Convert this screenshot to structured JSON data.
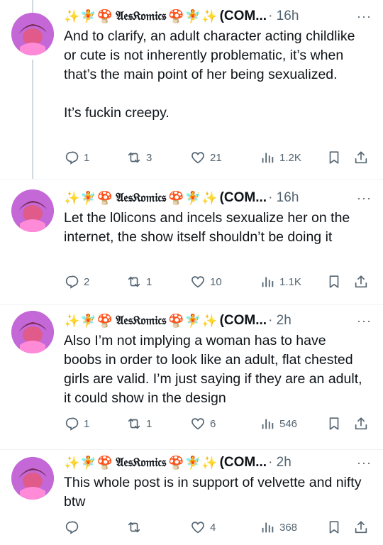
{
  "posts": [
    {
      "prefix_emoji": "✨🧚🍄",
      "name": "𝔄𝔢𝔰𝔎𝔬𝔪𝔦𝔠𝔰",
      "suffix_emoji": "🍄🧚✨",
      "handle": "(COM...",
      "meta": "· 16h",
      "text": "And to clarify, an adult character acting childlike or cute is not inherently problematic, it’s when that’s the main point of her being sexualized.\n\nIt’s fuckin creepy.",
      "replies": "1",
      "reposts": "3",
      "likes": "21",
      "views": "1.2K"
    },
    {
      "prefix_emoji": "✨🧚🍄",
      "name": "𝔄𝔢𝔰𝔎𝔬𝔪𝔦𝔠𝔰",
      "suffix_emoji": "🍄🧚✨",
      "handle": "(COM...",
      "meta": "· 16h",
      "text": "Let the l0licons and incels sexualize her on the internet, the show itself shouldn’t be doing it",
      "replies": "2",
      "reposts": "1",
      "likes": "10",
      "views": "1.1K"
    },
    {
      "prefix_emoji": "✨🧚🍄",
      "name": "𝔄𝔢𝔰𝔎𝔬𝔪𝔦𝔠𝔰",
      "suffix_emoji": "🍄🧚✨",
      "handle": "(COM...",
      "meta": "· 2h",
      "text": "Also I’m not implying a woman has to have boobs in order to look like an adult, flat chested girls are valid. I’m just saying if they are an adult, it could show in the design",
      "replies": "1",
      "reposts": "1",
      "likes": "6",
      "views": "546"
    },
    {
      "prefix_emoji": "✨🧚🍄",
      "name": "𝔄𝔢𝔰𝔎𝔬𝔪𝔦𝔠𝔰",
      "suffix_emoji": "🍄🧚✨",
      "handle": "(COM...",
      "meta": "· 2h",
      "text": "This whole post is in support of velvette and nifty btw",
      "replies": "",
      "reposts": "",
      "likes": "4",
      "views": "368"
    }
  ],
  "more_label": "···",
  "icons": {
    "reply": "reply-icon",
    "repost": "repost-icon",
    "like": "heart-icon",
    "views": "views-icon",
    "bookmark": "bookmark-icon",
    "share": "share-icon"
  },
  "colors": {
    "text": "#0f1419",
    "secondary": "#536471",
    "thread_line": "#cfd9de",
    "divider": "#eff3f4"
  }
}
